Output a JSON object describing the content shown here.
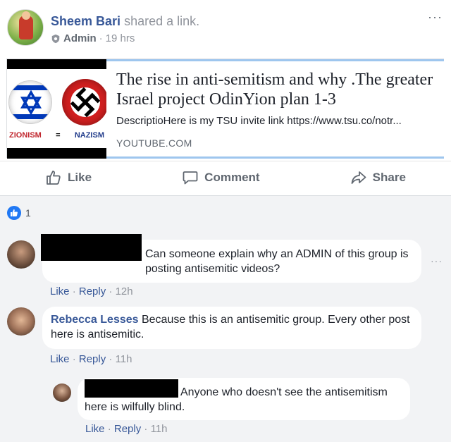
{
  "post": {
    "author": "Sheem Bari",
    "action_text": "shared a link.",
    "role": "Admin",
    "separator": "·",
    "time": "19 hrs",
    "more": "···",
    "link": {
      "title": "The rise in anti-semitism and why .The greater Israel project OdinYion plan 1-3",
      "description": "DescriptioHere is my TSU invite link https://www.tsu.co/notr...",
      "domain": "YOUTUBE.COM",
      "thumb_left_label": "ZIONISM",
      "thumb_eq": "=",
      "thumb_right_label": "NAZISM"
    },
    "actions": {
      "like": "Like",
      "comment": "Comment",
      "share": "Share"
    }
  },
  "reactions": {
    "count": "1"
  },
  "comments": [
    {
      "author": "",
      "text": "Can someone explain why an ADMIN of this group is posting antisemitic videos?",
      "like": "Like",
      "reply": "Reply",
      "time": "12h",
      "more": "···"
    },
    {
      "author": "Rebecca Lesses",
      "text": "Because this is an antisemitic group. Every other post here is antisemitic.",
      "like": "Like",
      "reply": "Reply",
      "time": "11h"
    },
    {
      "author": "",
      "text": "Anyone who doesn't see the antisemitism here is wilfully blind.",
      "like": "Like",
      "reply": "Reply",
      "time": "11h"
    }
  ],
  "colors": {
    "link_blue": "#385898",
    "meta_gray": "#90949c",
    "like_blue": "#2078f4",
    "comment_bg": "#f2f3f5"
  }
}
